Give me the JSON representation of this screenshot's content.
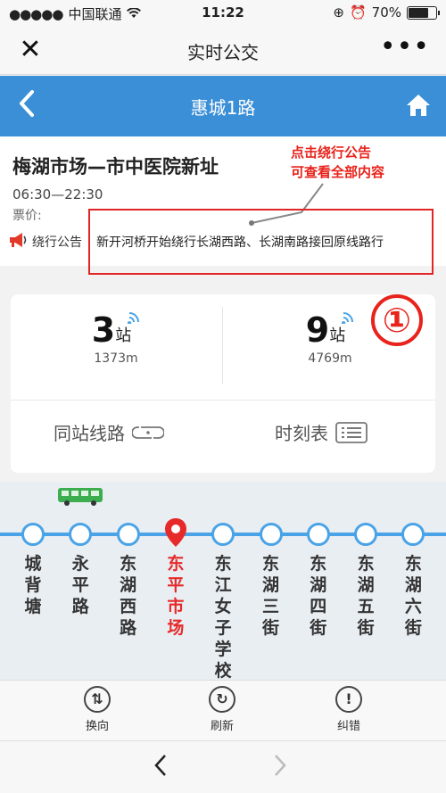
{
  "status_bar": {
    "carrier": "中国联通",
    "time": "11:22",
    "battery": "70%",
    "battery_level": 0.7
  },
  "wechat_nav": {
    "title": "实时公交",
    "close_icon": "close-icon",
    "more_icon": "more-icon"
  },
  "app_header": {
    "title": "惠城1路",
    "back_icon": "chevron-left-icon",
    "home_icon": "home-icon"
  },
  "route": {
    "name": "梅湖市场—市中医院新址",
    "hours": "06:30—22:30",
    "fare_label": "票价:",
    "notice_label": "绕行公告",
    "notice_text": "新开河桥开始绕行长湖西路、长湖南路接回原线路行"
  },
  "annotation": {
    "hint_line1": "点击绕行公告",
    "hint_line2": "可查看全部内容",
    "marker": "①",
    "color": "#e8231b"
  },
  "arrivals": {
    "first": {
      "stops": "3",
      "unit": "站",
      "distance": "1373m"
    },
    "second": {
      "stops": "9",
      "unit": "站",
      "distance": "4769m"
    }
  },
  "actions": {
    "same_station": "同站线路",
    "timetable": "时刻表"
  },
  "stops": [
    {
      "name": "城背塘"
    },
    {
      "name": "永平路"
    },
    {
      "name": "东湖西路"
    },
    {
      "name": "东平市场",
      "current": true
    },
    {
      "name": "东江女子学校"
    },
    {
      "name": "东湖三街"
    },
    {
      "name": "东湖四街"
    },
    {
      "name": "东湖五街"
    },
    {
      "name": "东湖六街"
    }
  ],
  "toolbar": {
    "reverse": "换向",
    "refresh": "刷新",
    "report": "纠错"
  },
  "colors": {
    "accent": "#3b8fd6",
    "track": "#4aa3e6",
    "current_stop": "#e62a2a"
  }
}
